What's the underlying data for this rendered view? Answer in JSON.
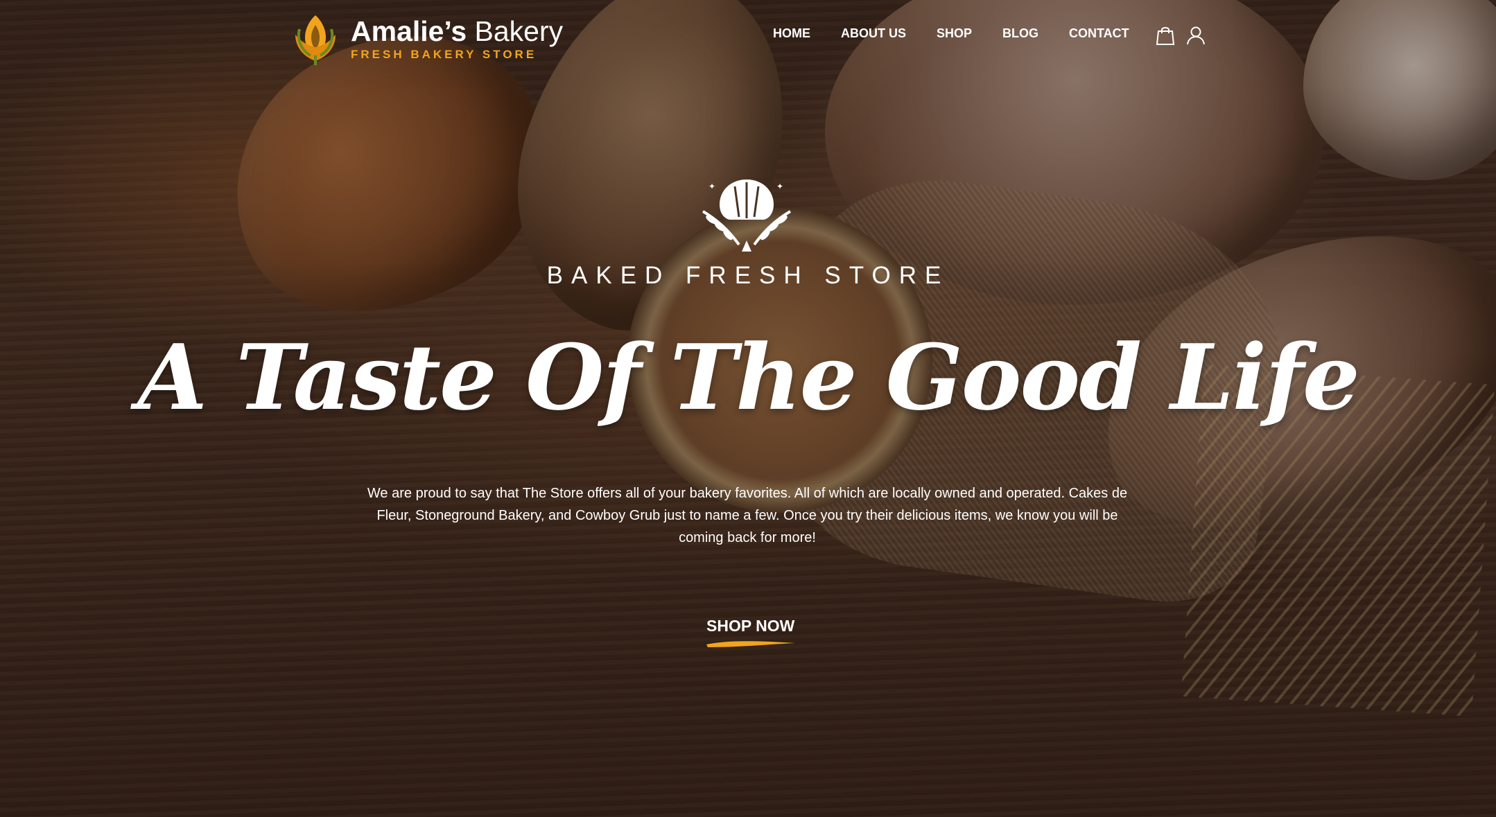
{
  "header": {
    "logo": {
      "name_bold": "Amalie’s",
      "name_light": " Bakery",
      "tagline": "FRESH BAKERY STORE"
    },
    "nav": [
      {
        "label": "HOME"
      },
      {
        "label": "ABOUT US"
      },
      {
        "label": "SHOP"
      },
      {
        "label": "BLOG"
      },
      {
        "label": "CONTACT"
      }
    ],
    "icons": [
      "shopping-bag-icon",
      "user-icon"
    ]
  },
  "hero": {
    "emblem_icon": "croissant-wheat-icon",
    "eyebrow": "BAKED FRESH STORE",
    "headline": "A Taste Of The Good Life",
    "intro": "We are proud to say that The Store offers all of your bakery favorites. All of which are locally owned and operated. Cakes de Fleur, Stoneground Bakery, and Cowboy Grub just to name a few. Once you try their delicious items, we know you will be coming back for more!",
    "cta_label": "SHOP NOW"
  },
  "colors": {
    "accent": "#f2a51c",
    "text": "#ffffff",
    "background": "#3e2a1f"
  }
}
